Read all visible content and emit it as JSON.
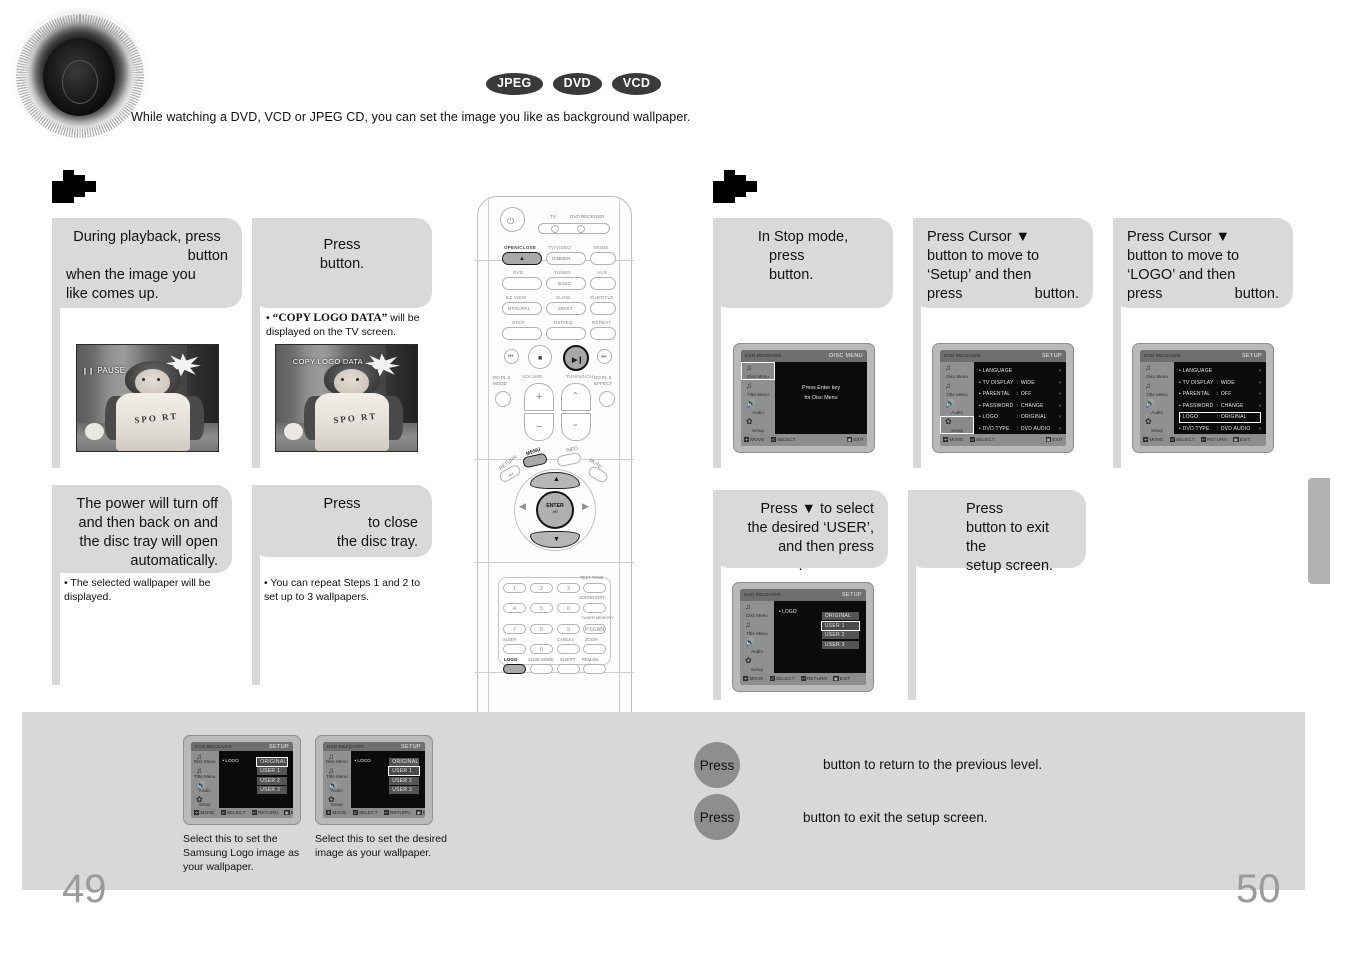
{
  "header": {
    "disc_icon": "cd-disc-icon",
    "badges": [
      "JPEG",
      "DVD",
      "VCD"
    ],
    "intro": "While watching a DVD, VCD or JPEG CD, you can set the image you like as background wallpaper."
  },
  "left_page": {
    "marker_icon": "checkered-arrow-icon",
    "page_number": "49",
    "steps": [
      {
        "id": "step-1",
        "text_lines": [
          "During playback, press",
          "button",
          "when the image you",
          "like comes up."
        ],
        "photo": {
          "osd": "PAUSE",
          "alt": "paused video frame of a child"
        }
      },
      {
        "id": "step-2",
        "text_lines": [
          "Press",
          "button."
        ],
        "note_quote": "“COPY LOGO DATA”",
        "note_rest": " will be displayed on the TV screen.",
        "photo": {
          "osd": "COPY LOGO DATA",
          "alt": "video frame with COPY LOGO DATA message"
        }
      },
      {
        "id": "step-3",
        "text_lines": [
          "The power will turn off",
          "and then back on and",
          "the disc tray will open",
          "automatically."
        ],
        "note": "The selected wallpaper will be displayed."
      },
      {
        "id": "step-4",
        "text_lines": [
          "Press",
          "to close",
          "the disc tray."
        ],
        "note": "You can repeat Steps 1 and 2 to set up to 3 wallpapers."
      }
    ],
    "mini_shots": [
      {
        "caption": "Select this to set the Samsung Logo image as your wallpaper.",
        "title": "SETUP",
        "row_label": "LOGO",
        "options": [
          "ORIGINAL",
          "USER 1",
          "USER 2",
          "USER 3"
        ],
        "selected": "ORIGINAL"
      },
      {
        "caption": "Select this to set the desired image as your wallpaper.",
        "title": "SETUP",
        "row_label": "LOGO",
        "options": [
          "ORIGINAL",
          "USER 1",
          "USER 2",
          "USER 3"
        ],
        "selected": "USER 1"
      }
    ]
  },
  "right_page": {
    "marker_icon": "checkered-arrow-icon",
    "page_number": "50",
    "steps": [
      {
        "id": "step-1",
        "text_lines": [
          "In Stop mode,",
          "press",
          "button."
        ],
        "screen": {
          "top_left": "DVD RECEIVER",
          "top_right": "DISC MENU",
          "center_lines": [
            "Press Enter key",
            "for Disc Menu"
          ],
          "side_items": [
            "Disc Menu",
            "Title Menu",
            "Audio",
            "Setup"
          ],
          "selected_side": "Disc Menu",
          "footer": [
            "MOVE",
            "SELECT",
            "EXIT"
          ]
        }
      },
      {
        "id": "step-2",
        "text_lines": [
          "Press Cursor ▼",
          "button to move to",
          "‘Setup’ and then",
          "press",
          "button."
        ],
        "screen": {
          "top_left": "DVD RECEIVER",
          "top_right": "SETUP",
          "side_items": [
            "Disc Menu",
            "Title Menu",
            "Audio",
            "Setup"
          ],
          "selected_side": "Setup",
          "rows": [
            {
              "label": "LANGUAGE",
              "value": ""
            },
            {
              "label": "TV  DISPLAY",
              "value": "WIDE"
            },
            {
              "label": "PARENTAL",
              "value": "OFF"
            },
            {
              "label": "PASSWORD",
              "value": "CHANGE"
            },
            {
              "label": "LOGO",
              "value": "ORIGINAL"
            },
            {
              "label": "DVD TYPE",
              "value": "DVD AUDIO"
            }
          ],
          "footer": [
            "MOVE",
            "SELECT",
            "EXIT"
          ]
        }
      },
      {
        "id": "step-3",
        "text_lines": [
          "Press Cursor ▼",
          "button to move to",
          "‘LOGO’ and then",
          "press",
          "button."
        ],
        "screen": {
          "top_left": "DVD RECEIVER",
          "top_right": "SETUP",
          "side_items": [
            "Disc Menu",
            "Title Menu",
            "Audio",
            "Setup"
          ],
          "rows": [
            {
              "label": "LANGUAGE",
              "value": ""
            },
            {
              "label": "TV DISPLAY",
              "value": "WIDE"
            },
            {
              "label": "PARENTAL",
              "value": "OFF"
            },
            {
              "label": "PASSWORD",
              "value": "CHANGE"
            },
            {
              "label": "LOGO",
              "value": "ORIGINAL"
            },
            {
              "label": "DVD TYPE",
              "value": "DVD AUDIO"
            }
          ],
          "selected_row": "LOGO",
          "footer": [
            "MOVE",
            "SELECT",
            "RETURN",
            "EXIT"
          ]
        }
      },
      {
        "id": "step-4",
        "text_lines": [
          "Press ▼ to select",
          "the desired ‘USER’,",
          "and then press",
          "."
        ],
        "screen": {
          "top_left": "DVD RECEIVER",
          "top_right": "SETUP",
          "side_items": [
            "Disc Menu",
            "Title Menu",
            "Audio",
            "Setup"
          ],
          "row_label": "LOGO",
          "options": [
            "ORIGINAL",
            "USER 1",
            "USER 2",
            "USER 3"
          ],
          "selected": "USER 1",
          "footer": [
            "MOVE",
            "SELECT",
            "RETURN",
            "EXIT"
          ]
        }
      },
      {
        "id": "step-5",
        "text_lines": [
          "Press",
          "button to exit the",
          "setup screen."
        ]
      }
    ],
    "press_notes": [
      {
        "press": "Press",
        "text": "button to return to the previous level."
      },
      {
        "press": "Press",
        "text": "button to exit the setup screen."
      }
    ]
  },
  "remote": {
    "name": "dvd-remote-control",
    "top_labels": {
      "tv": "TV",
      "dvd_receiver": "DVD RECEIVER"
    },
    "buttons": [
      {
        "label": "OPEN/CLOSE",
        "highlighted": true
      },
      {
        "label": "TV/VIDEO",
        "sub": "DIMMER",
        "highlighted": false
      },
      {
        "label": "MODE",
        "highlighted": false
      },
      {
        "label": "DVD",
        "highlighted": false
      },
      {
        "label": "TUNER",
        "sub": "BAND",
        "highlighted": false
      },
      {
        "label": "AUX",
        "highlighted": false
      },
      {
        "label": "EZ VIEW",
        "sub": "NTSC/PAL",
        "highlighted": false
      },
      {
        "label": "SLOW",
        "sub": "MO/ST",
        "highlighted": false
      },
      {
        "label": "SUBTITLE",
        "highlighted": false
      },
      {
        "label": "STEP",
        "highlighted": false
      },
      {
        "label": "DSP/EQ",
        "highlighted": false
      },
      {
        "label": "REPEAT",
        "highlighted": false
      }
    ],
    "transport": {
      "prev": "⏮",
      "stop": "■",
      "play_pause": "▶❙",
      "next": "⏭"
    },
    "volume_label": "VOLUME",
    "tuning_label": "TUNING/CH",
    "left_mode": "DD PL II MODE",
    "right_effect": "DD PL II EFFECT",
    "nav": {
      "menu": "MENU",
      "info": "INFO",
      "return": "RETURN",
      "mute": "MUTE",
      "enter": "ENTER"
    },
    "numpad": {
      "keys": [
        "1",
        "2",
        "3",
        "4",
        "5",
        "6",
        "7",
        "8",
        "9",
        "0"
      ],
      "side_labels": [
        "TEST TONE",
        "SOUND EDIT",
        "TUNER MEMORY",
        "P.SCAN",
        "ZOOM",
        "REMAIN"
      ],
      "bottom_labels": [
        "SLEEP",
        "CANCEL",
        "LOGO",
        "SLIDE MODE",
        "INSERT"
      ],
      "highlighted": "LOGO"
    }
  }
}
